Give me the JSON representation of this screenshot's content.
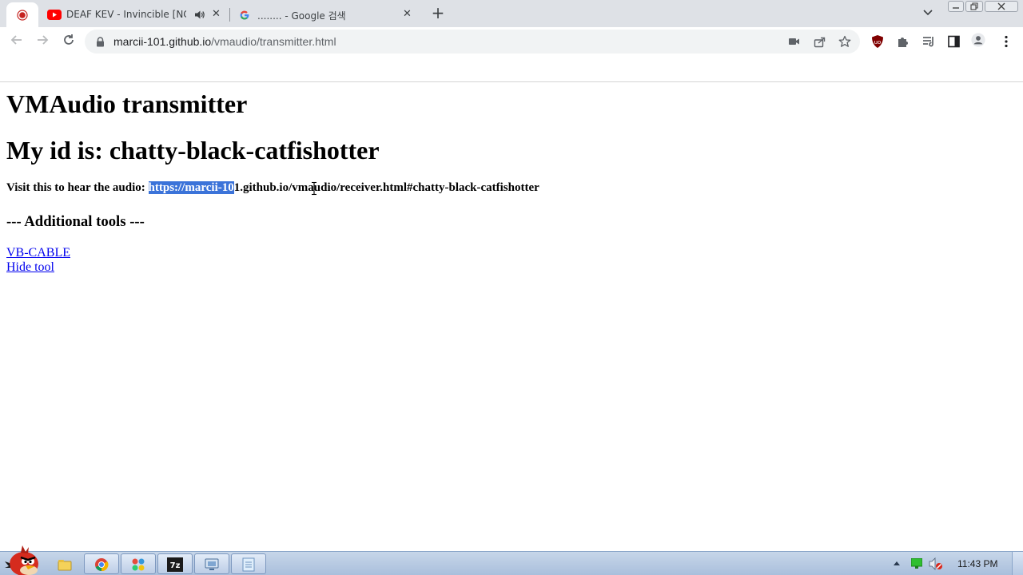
{
  "browser": {
    "tabs": [
      {
        "title": "DEAF KEV - Invincible [NC",
        "icon": "youtube-icon",
        "audio": "speaker-icon"
      },
      {
        "title": "........ - Google 검색",
        "icon": "google-icon"
      }
    ],
    "address": {
      "host": "marcii-101.github.io",
      "path": "/vmaudio/transmitter.html"
    },
    "colors": {
      "accent": "#3b73d9",
      "tabstrip": "#dee1e6",
      "link": "#0000ee"
    }
  },
  "page": {
    "heading": "VMAudio transmitter",
    "id_heading": "My id is: chatty-black-catfishotter",
    "visit_label": "Visit this to hear the audio: ",
    "visit_link_selected": "https://marcii-10",
    "visit_link_rest": "1.github.io/vmaudio/receiver.html#chatty-black-catfishotter",
    "tools_heading": "--- Additional tools ---",
    "links": [
      "VB-CABLE",
      "Hide tool"
    ]
  },
  "taskbar": {
    "apps": [
      "angry-birds-icon",
      "explorer-icon",
      "chrome-icon",
      "app-grid-icon",
      "7zip-icon",
      "remote-icon",
      "notepad-icon"
    ],
    "time": "11:43 PM"
  }
}
